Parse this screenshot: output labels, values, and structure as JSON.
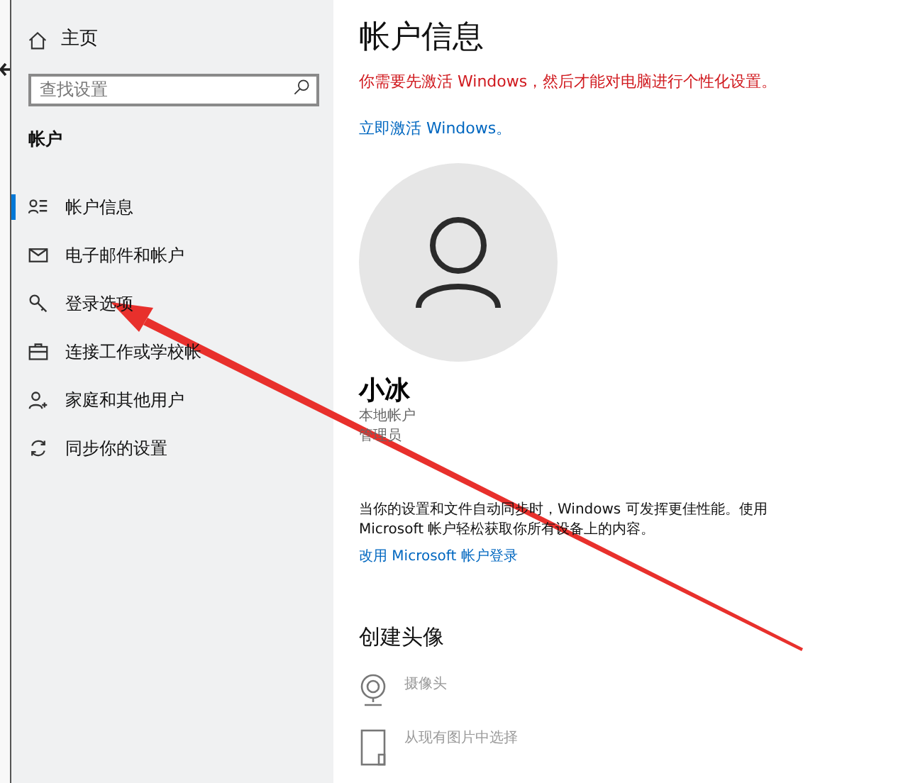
{
  "sidebar": {
    "home": "主页",
    "search": {
      "placeholder": "查找设置"
    },
    "section": "帐户",
    "items": [
      {
        "label": "帐户信息",
        "kind": "person-list",
        "selected": true
      },
      {
        "label": "电子邮件和帐户",
        "kind": "mail",
        "selected": false
      },
      {
        "label": "登录选项",
        "kind": "key",
        "selected": false
      },
      {
        "label": "连接工作或学校帐",
        "kind": "briefcase",
        "selected": false
      },
      {
        "label": "家庭和其他用户",
        "kind": "person-add",
        "selected": false
      },
      {
        "label": "同步你的设置",
        "kind": "sync",
        "selected": false
      }
    ]
  },
  "main": {
    "title": "帐户信息",
    "warning": "你需要先激活 Windows，然后才能对电脑进行个性化设置。",
    "activate_link": "立即激活 Windows。",
    "user": {
      "name": "小冰",
      "type": "本地帐户",
      "role": "管理员"
    },
    "sync_text": "当你的设置和文件自动同步时，Windows 可发挥更佳性能。使用 Microsoft 帐户轻松获取你所有设备上的内容。",
    "ms_link": "改用 Microsoft 帐户登录",
    "avatar_section": "创建头像",
    "avatar_options": [
      {
        "label": "摄像头",
        "kind": "camera"
      },
      {
        "label": "从现有图片中选择",
        "kind": "picture"
      }
    ]
  }
}
